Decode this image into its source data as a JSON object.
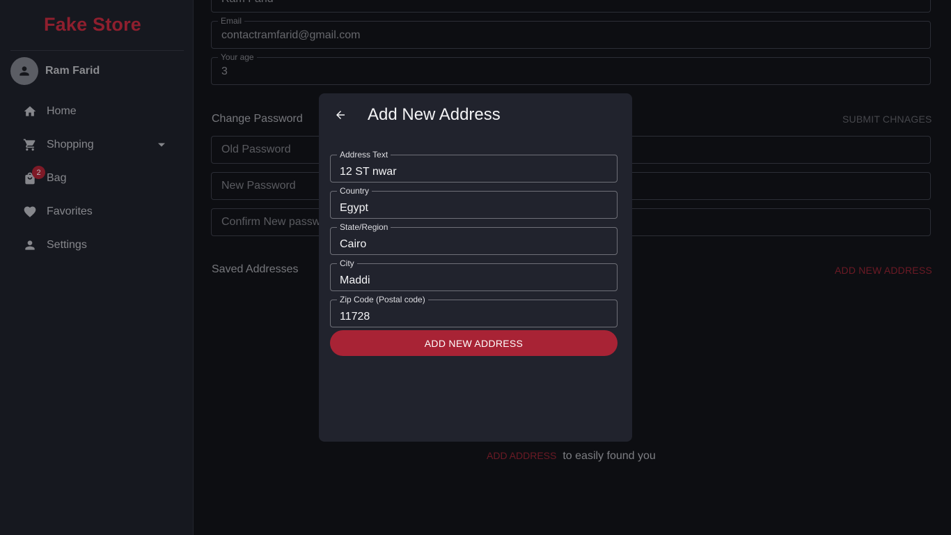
{
  "app": {
    "brand": "Fake Store"
  },
  "user": {
    "name": "Ram Farid"
  },
  "nav": [
    {
      "label": "Home",
      "icon": "home-icon"
    },
    {
      "label": "Shopping",
      "icon": "cart-icon"
    },
    {
      "label": "Bag",
      "icon": "bag-icon",
      "badge": "2"
    },
    {
      "label": "Favorites",
      "icon": "heart-icon"
    },
    {
      "label": "Settings",
      "icon": "person-icon"
    }
  ],
  "profile": {
    "name_value": "Ram Farid",
    "email_label": "Email",
    "email_value": "contactramfarid@gmail.com",
    "age_label": "Your age",
    "age_value": "3"
  },
  "password": {
    "title": "Change Password",
    "submit_label": "SUBMIT CHNAGES",
    "old_placeholder": "Old Password",
    "new_placeholder": "New Password",
    "confirm_placeholder": "Confirm New password"
  },
  "addresses": {
    "title": "Saved Addresses",
    "add_label": "ADD NEW ADDRESS",
    "empty_link": "ADD ADDRESS",
    "empty_text": "to easily found you"
  },
  "modal": {
    "title": "Add New Address",
    "fields": [
      {
        "label": "Address Text",
        "value": "12 ST nwar"
      },
      {
        "label": "Country",
        "value": "Egypt"
      },
      {
        "label": "State/Region",
        "value": "Cairo"
      },
      {
        "label": "City",
        "value": "Maddi"
      },
      {
        "label": "Zip Code (Postal code)",
        "value": "11728"
      }
    ],
    "submit_label": "ADD NEW ADDRESS"
  },
  "colors": {
    "accent": "#a82335",
    "modal_bg": "#21232d",
    "page_bg": "#0d0e12",
    "sidebar_bg": "#16181f"
  }
}
